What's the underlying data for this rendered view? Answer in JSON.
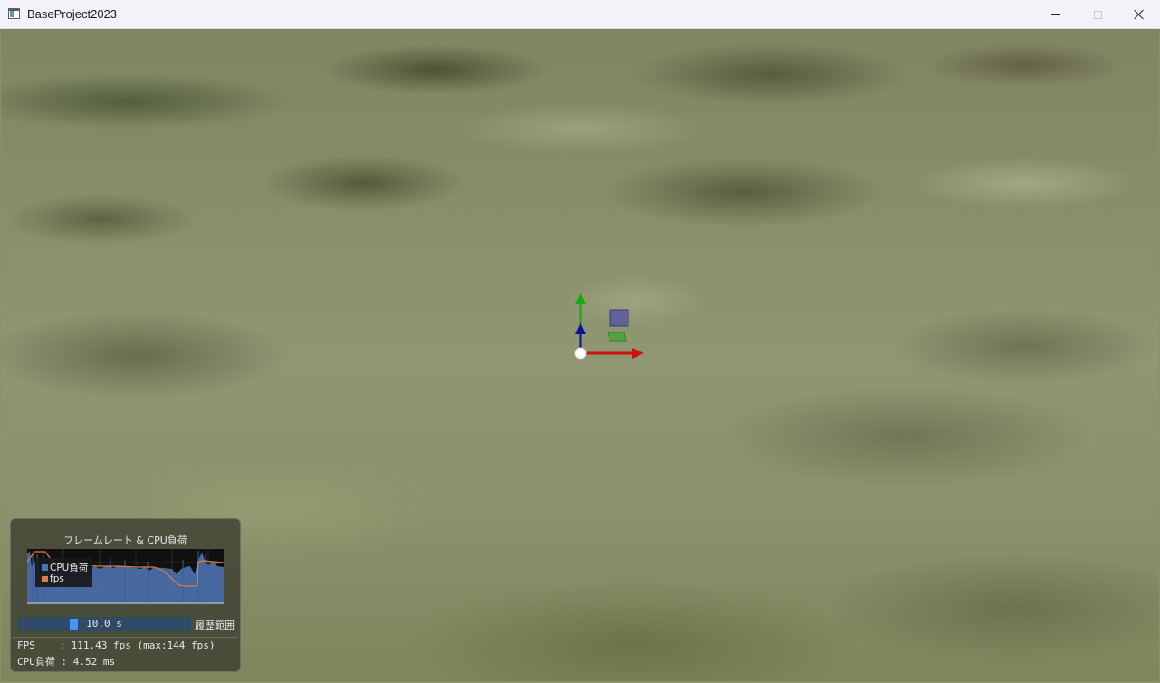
{
  "window": {
    "title": "BaseProject2023",
    "icon": "app-window-icon",
    "controls": [
      "minimize-icon",
      "maximize-icon",
      "close-icon"
    ]
  },
  "gizmo": {
    "colors": {
      "x_axis": "#cc1111",
      "y_axis": "#11aa11",
      "z_axis": "#111199",
      "origin": "#ffffff"
    }
  },
  "overlay": {
    "title": "フレームレート & CPU負荷",
    "legend": [
      {
        "label": "CPU負荷",
        "color": "#4a73b8"
      },
      {
        "label": "fps",
        "color": "#e07b45"
      }
    ],
    "history_slider": {
      "value": "10.0 s",
      "label": "履歴範囲"
    },
    "fps_line": "FPS    : 111.43 fps (max:144 fps)",
    "cpu_line": "CPU負荷 : 4.52 ms"
  }
}
